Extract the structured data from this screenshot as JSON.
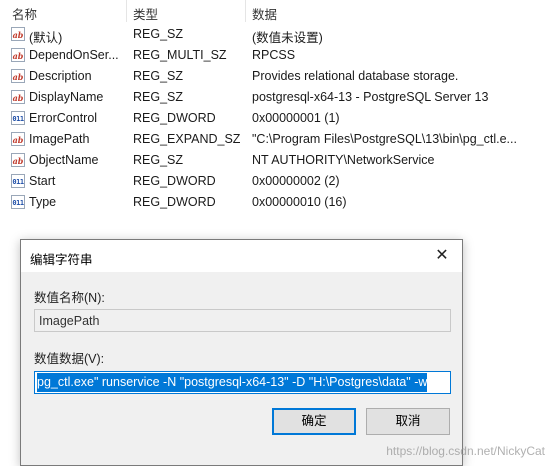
{
  "columns": {
    "name": "名称",
    "type": "类型",
    "data": "数据"
  },
  "rows": [
    {
      "icon": "string-value-icon",
      "glyph": "ab",
      "name": "(默认)",
      "type": "REG_SZ",
      "value": "(数值未设置)"
    },
    {
      "icon": "string-value-icon",
      "glyph": "ab",
      "name": "DependOnSer...",
      "type": "REG_MULTI_SZ",
      "value": "RPCSS"
    },
    {
      "icon": "string-value-icon",
      "glyph": "ab",
      "name": "Description",
      "type": "REG_SZ",
      "value": "Provides relational database storage."
    },
    {
      "icon": "string-value-icon",
      "glyph": "ab",
      "name": "DisplayName",
      "type": "REG_SZ",
      "value": "postgresql-x64-13 - PostgreSQL Server 13"
    },
    {
      "icon": "binary-value-icon",
      "glyph": "011",
      "name": "ErrorControl",
      "type": "REG_DWORD",
      "value": "0x00000001 (1)"
    },
    {
      "icon": "string-value-icon",
      "glyph": "ab",
      "name": "ImagePath",
      "type": "REG_EXPAND_SZ",
      "value": "\"C:\\Program Files\\PostgreSQL\\13\\bin\\pg_ctl.e..."
    },
    {
      "icon": "string-value-icon",
      "glyph": "ab",
      "name": "ObjectName",
      "type": "REG_SZ",
      "value": "NT AUTHORITY\\NetworkService"
    },
    {
      "icon": "binary-value-icon",
      "glyph": "011",
      "name": "Start",
      "type": "REG_DWORD",
      "value": "0x00000002 (2)"
    },
    {
      "icon": "binary-value-icon",
      "glyph": "011",
      "name": "Type",
      "type": "REG_DWORD",
      "value": "0x00000010 (16)"
    }
  ],
  "dialog": {
    "title": "编辑字符串",
    "close_glyph": "✕",
    "value_name_label": "数值名称(N):",
    "value_name": "ImagePath",
    "value_data_label": "数值数据(V):",
    "value_data": "pg_ctl.exe\" runservice -N \"postgresql-x64-13\" -D \"H:\\Postgres\\data\" -w",
    "ok_label": "确定",
    "cancel_label": "取消"
  },
  "watermark": "https://blog.csdn.net/NickyCat",
  "colors": {
    "accent": "#0078d7",
    "dialog_bg": "#f0f0f0"
  }
}
